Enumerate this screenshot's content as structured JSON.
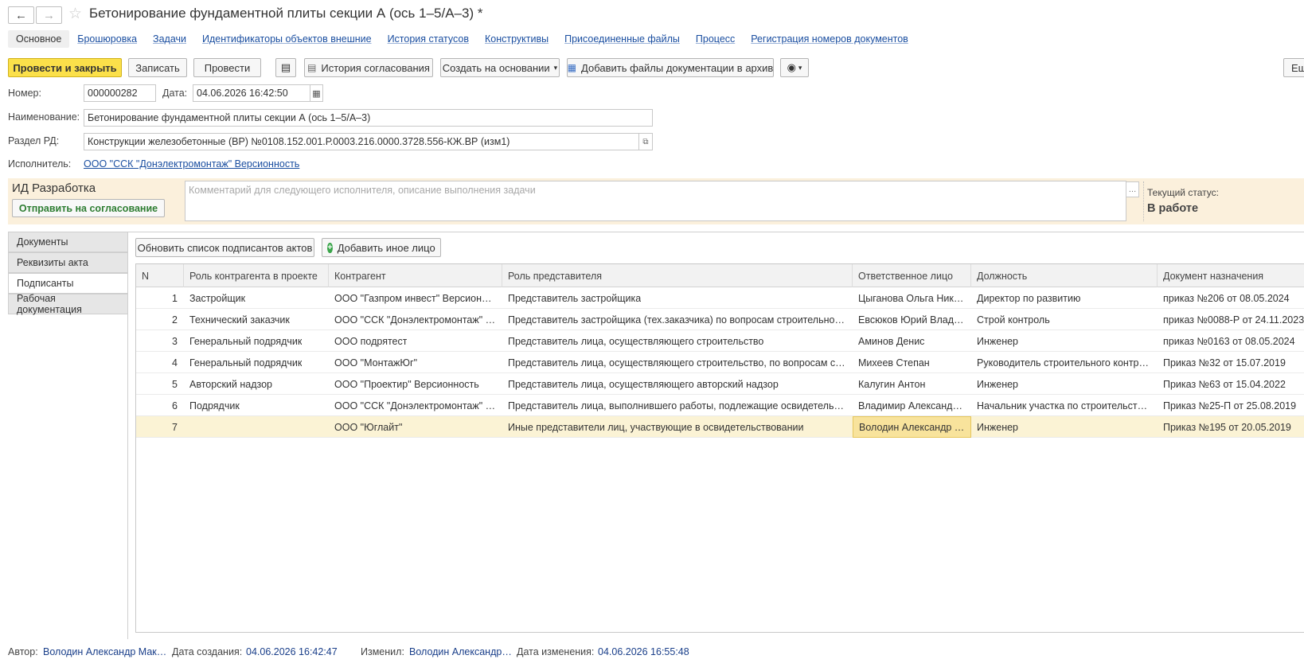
{
  "window": {
    "title": "Бетонирование фундаментной плиты секции А (ось 1–5/А–3) *"
  },
  "nav": {
    "back_icon": "arrow-left-icon",
    "forward_icon": "arrow-right-icon",
    "favorite_icon": "star-icon"
  },
  "top_tabs": [
    {
      "label": "Основное",
      "active": true
    },
    {
      "label": "Брошюровка"
    },
    {
      "label": "Задачи"
    },
    {
      "label": "Идентификаторы объектов внешние"
    },
    {
      "label": "История статусов"
    },
    {
      "label": "Конструктивы"
    },
    {
      "label": "Присоединенные файлы"
    },
    {
      "label": "Процесс"
    },
    {
      "label": "Регистрация номеров документов"
    }
  ],
  "toolbar": {
    "post_close": "Провести и закрыть",
    "save": "Записать",
    "post": "Провести",
    "approval_history": "История согласования",
    "create_based": "Создать на основании",
    "add_files": "Добавить файлы документации в архив",
    "more": "Ещ"
  },
  "form": {
    "number_label": "Номер:",
    "number_value": "000000282",
    "date_label": "Дата:",
    "date_value": "04.06.2026 16:42:50",
    "name_label": "Наименование:",
    "name_value": "Бетонирование фундаментной плиты секции А (ось 1–5/А–3)",
    "section_label": "Раздел РД:",
    "section_value": "Конструкции железобетонные (ВР) №0108.152.001.Р.0003.216.0000.3728.556-КЖ.ВР (изм1)",
    "executor_label": "Исполнитель:",
    "executor_value": "ООО \"ССК \"Донэлектромонтаж\" Версионность"
  },
  "stage_panel": {
    "stage_title": "ИД Разработка",
    "send_button": "Отправить на согласование",
    "comment_placeholder": "Комментарий для следующего исполнителя, описание выполнения задачи",
    "status_label": "Текущий статус:",
    "status_value": "В работе"
  },
  "side_tabs": [
    {
      "label": "Документы"
    },
    {
      "label": "Реквизиты акта"
    },
    {
      "label": "Подписанты",
      "active": true
    },
    {
      "label": "Рабочая документация"
    }
  ],
  "grid_toolbar": {
    "refresh": "Обновить список подписантов актов",
    "add_other": "Добавить иное лицо"
  },
  "grid": {
    "columns": [
      "N",
      "Роль контрагента в проекте",
      "Контрагент",
      "Роль представителя",
      "Ответственное лицо",
      "Должность",
      "Документ назначения"
    ],
    "rows": [
      [
        "1",
        "Застройщик",
        "ООО \"Газпром инвест\" Версионно…",
        "Представитель застройщика",
        "Цыганова Ольга Ник…",
        "Директор по развитию",
        "приказ №206 от 08.05.2024"
      ],
      [
        "2",
        "Технический заказчик",
        "ООО \"ССК \"Донэлектромонтаж\" В…",
        "Представитель застройщика (тех.заказчика) по вопросам строительного к…",
        "Евсюков Юрий Влад…",
        "Строй контроль",
        "приказ №0088-Р от 24.11.2023"
      ],
      [
        "3",
        "Генеральный подрядчик",
        "ООО подрятест",
        "Представитель лица, осуществляющего строительство",
        "Аминов Денис",
        "Инженер",
        "приказ №0163 от 08.05.2024"
      ],
      [
        "4",
        "Генеральный подрядчик",
        "ООО \"МонтажЮг\"",
        "Представитель лица, осуществляющего строительство, по вопросам стро…",
        "Михеев Степан",
        "Руководитель строительного контроля",
        "Приказ №32 от 15.07.2019"
      ],
      [
        "5",
        "Авторский надзор",
        "ООО \"Проектир\" Версионность",
        "Представитель лица, осуществляющего авторский надзор",
        "Калугин Антон",
        "Инженер",
        "Приказ №63 от 15.04.2022"
      ],
      [
        "6",
        "Подрядчик",
        "ООО \"ССК \"Донэлектромонтаж\" В…",
        "Представитель лица, выполнившего работы, подлежащие освидетельств…",
        "Владимир Александр…",
        "Начальник участка по строительству…",
        "Приказ №25-П от 25.08.2019"
      ],
      [
        "7",
        "",
        "ООО \"Юглайт\"",
        "Иные представители лиц, участвующие в освидетельствовании",
        "Володин Александр …",
        "Инженер",
        "Приказ №195 от 20.05.2019"
      ]
    ],
    "selected_row": 7
  },
  "footer": {
    "author_label": "Автор:",
    "author_value": "Володин Александр Мак…",
    "created_label": "Дата создания:",
    "created_value": "04.06.2026 16:42:47",
    "modified_by_label": "Изменил:",
    "modified_by_value": "Володин Александр…",
    "modified_label": "Дата изменения:",
    "modified_value": "04.06.2026 16:55:48"
  },
  "colors": {
    "primary_button": "#fbe04a",
    "stage_panel_bg": "#fbf0dc",
    "link": "#1a4ea0",
    "selected_row": "#fbf3d5",
    "send_button_text": "#2e7d32"
  }
}
